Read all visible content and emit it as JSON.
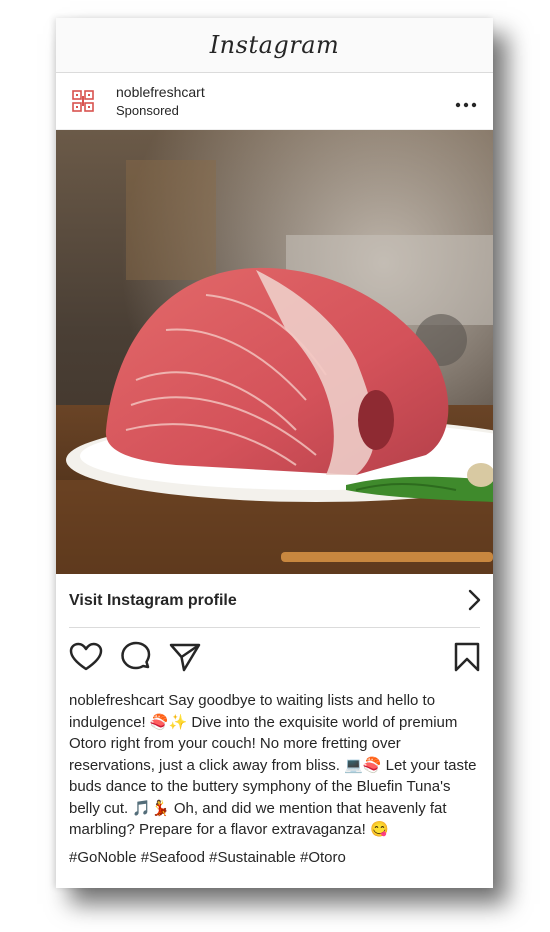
{
  "app": {
    "title": "Instagram"
  },
  "post": {
    "username": "noblefreshcart",
    "sponsored_label": "Sponsored",
    "more_icon": "ellipsis-icon",
    "visit_profile_label": "Visit Instagram profile",
    "caption_username": "noblefreshcart",
    "caption_text": "Say goodbye to waiting lists and hello to indulgence! 🍣✨ Dive into the exquisite world of premium Otoro right from your couch! No more fretting over reservations, just a click away from bliss. 💻🍣 Let your taste buds dance to the buttery symphony of the Bluefin Tuna's belly cut. 🎵💃 Oh, and did we mention that heavenly fat marbling? Prepare for a flavor extravaganza! 😋",
    "hashtags": "#GoNoble #Seafood #Sustainable #Otoro"
  },
  "colors": {
    "text": "#262626",
    "divider": "#dbdbdb",
    "logo_red": "#d9534f"
  },
  "icons": [
    "heart-icon",
    "comment-icon",
    "share-icon",
    "bookmark-icon",
    "chevron-right-icon"
  ]
}
